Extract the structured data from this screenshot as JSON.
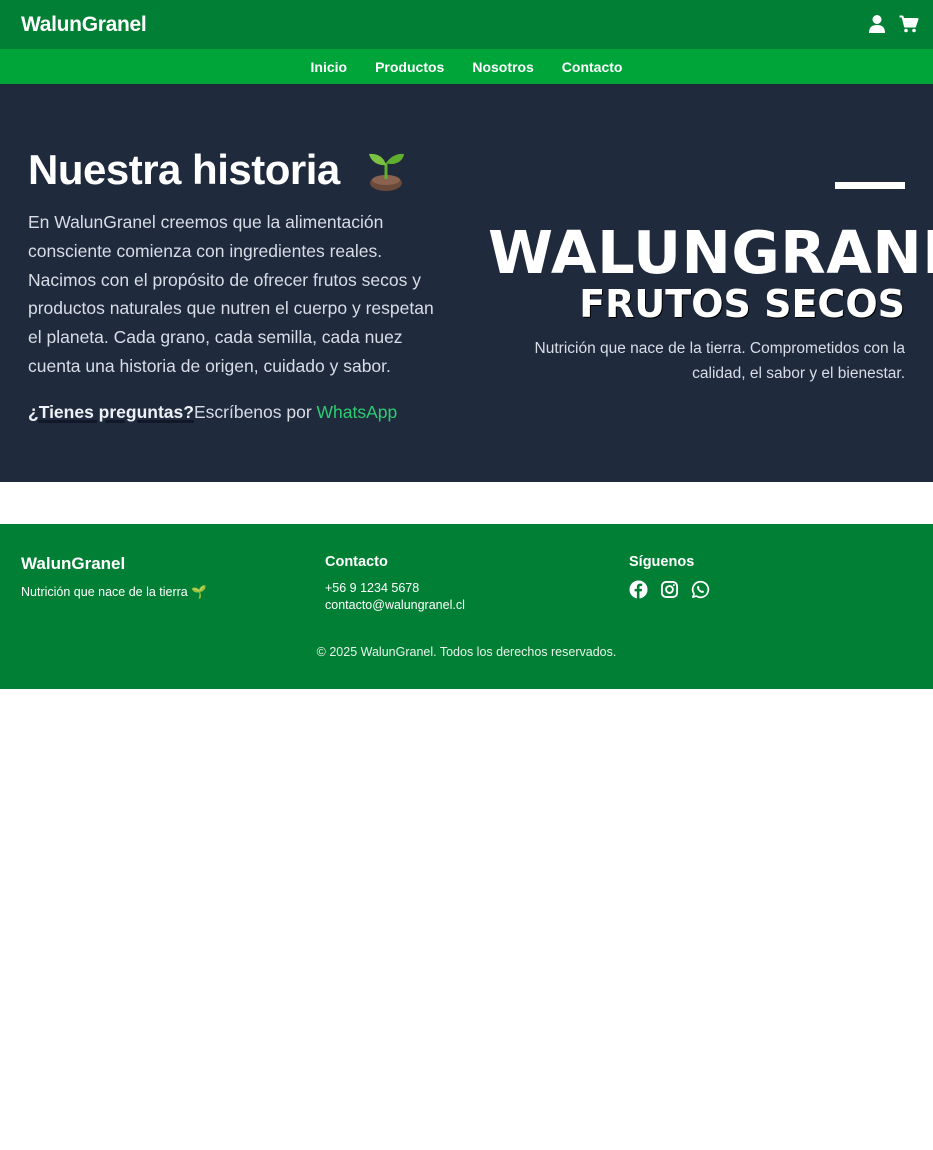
{
  "header": {
    "brand": "WalunGranel",
    "icons": [
      "user-icon",
      "cart-icon"
    ]
  },
  "nav": {
    "items": [
      {
        "label": "Inicio"
      },
      {
        "label": "Productos"
      },
      {
        "label": "Nosotros"
      },
      {
        "label": "Contacto"
      }
    ]
  },
  "hero": {
    "title": "Nuestra historia",
    "title_icon": "sprout-icon",
    "paragraph": "En WalunGranel creemos que la alimentación consciente comienza con ingredientes reales. Nacimos con el propósito de ofrecer frutos secos y productos naturales que nutren el cuerpo y respetan el planeta. Cada grano, cada semilla, cada nuez cuenta una historia de origen, cuidado y sabor.",
    "question": "¿Tienes preguntas?",
    "question_rest": "Escríbenos por ",
    "whatsapp_link": "WhatsApp",
    "big_brand": "WALUNGRANEL",
    "big_sub": "FRUTOS SECOS",
    "tagline": "Nutrición que nace de la tierra. Comprometidos con la calidad, el sabor y el bienestar."
  },
  "footer": {
    "brand": "WalunGranel",
    "brand_tagline": "Nutrición que nace de la tierra 🌱",
    "contact_title": "Contacto",
    "phone": "+56 9 1234 5678",
    "email": "contacto@walungranel.cl",
    "social_title": "Síguenos",
    "social_icons": [
      "facebook-icon",
      "instagram-icon",
      "whatsapp-icon"
    ],
    "copyright": "© 2025 WalunGranel. Todos los derechos reservados."
  },
  "colors": {
    "topbar": "#017f34",
    "navbar": "#00a53a",
    "hero_bg": "#1f2a3d",
    "link_green": "#2ecc71",
    "footer": "#017f34"
  }
}
